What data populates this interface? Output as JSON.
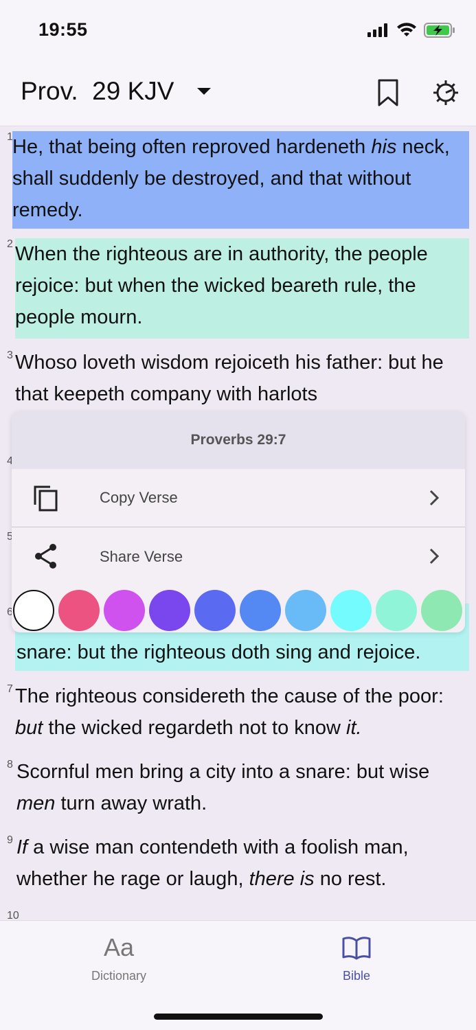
{
  "status_bar": {
    "time": "19:55"
  },
  "header": {
    "reference": "Prov.  29 KJV"
  },
  "verses": {
    "v1": {
      "num": "1",
      "a": "He, that being often reproved hardeneth ",
      "b": "his",
      "c": " neck, shall suddenly be destroyed, and that without remedy."
    },
    "v2": {
      "num": "2",
      "text": "When the righteous are in authority, the people rejoice: but when the wicked beareth rule, the people mourn."
    },
    "v3": {
      "num": "3",
      "text": "Whoso loveth wisdom rejoiceth his father: but he that keepeth company with harlots"
    },
    "v4": {
      "num": "4"
    },
    "v5": {
      "num": "5"
    },
    "v6": {
      "num": "6",
      "text": "snare: but the righteous doth sing and rejoice."
    },
    "v7": {
      "num": "7",
      "a": "The righteous considereth the cause of the poor: ",
      "b": "but",
      "c": " the wicked regardeth not to know ",
      "d": "it."
    },
    "v8": {
      "num": "8",
      "a": "Scornful men bring a city into a snare: but wise ",
      "b": "men",
      "c": " turn away wrath."
    },
    "v9": {
      "num": "9",
      "a": "If",
      "b": " a wise man contendeth with a foolish man, whether he rage or laugh, ",
      "c": "there is",
      "d": " no rest."
    },
    "v10": {
      "num": "10"
    }
  },
  "popup": {
    "title": "Proverbs 29:7",
    "copy_label": "Copy Verse",
    "share_label": "Share Verse",
    "swatches": [
      "#ffffff",
      "#ec5381",
      "#cf52ee",
      "#7a47ee",
      "#5a6bf2",
      "#5488f3",
      "#68bbf7",
      "#74fbfd",
      "#8ff4d8",
      "#8ee8b1"
    ]
  },
  "tabbar": {
    "dictionary_icon": "Aa",
    "dictionary_label": "Dictionary",
    "bible_label": "Bible"
  },
  "colors": {
    "accent": "#4a4fa6",
    "highlight_blue": "#8fb1f7",
    "highlight_mint": "#bdf0e2",
    "highlight_cyan": "#b2f3f2"
  }
}
